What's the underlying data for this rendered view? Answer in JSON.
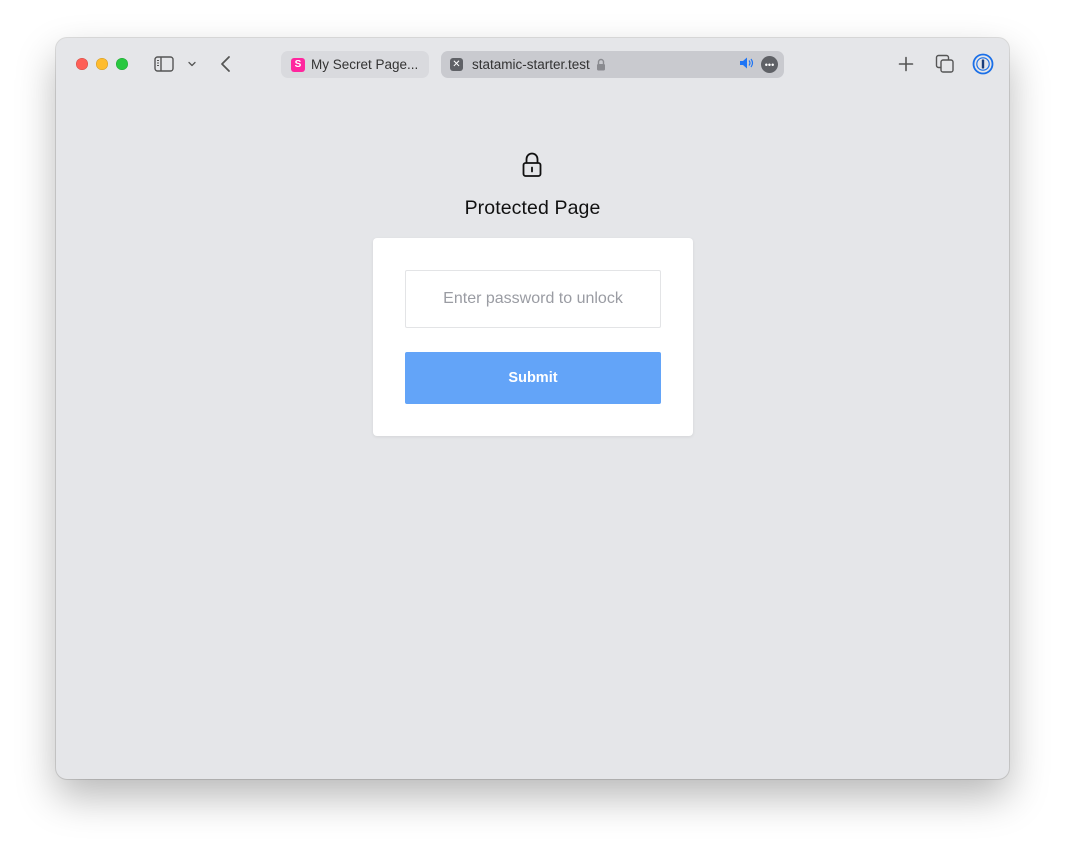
{
  "browser": {
    "tabs": [
      {
        "label": "My Secret Page...",
        "favicon": "S",
        "favicon_color": "#ff269e"
      },
      {
        "label": "statamic-starter.test",
        "favicon": "close-square-icon"
      }
    ],
    "more_label": "•••"
  },
  "page": {
    "icon": "lock-icon",
    "title": "Protected Page",
    "password_placeholder": "Enter password to unlock",
    "submit_label": "Submit"
  },
  "colors": {
    "background": "#e5e6e9",
    "button": "#63a4f8",
    "card": "#ffffff"
  }
}
